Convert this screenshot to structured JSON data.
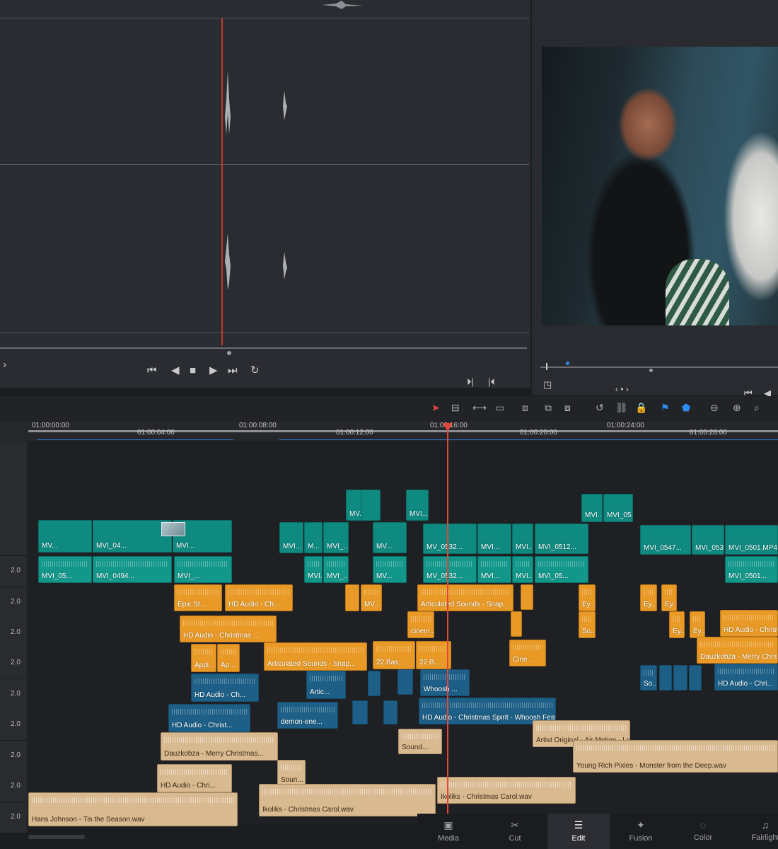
{
  "source_transport": {
    "icons": [
      "go-to-start-icon",
      "step-back-icon",
      "stop-icon",
      "play-icon",
      "go-to-end-icon",
      "loop-icon"
    ],
    "glyphs": [
      "⏮",
      "◀",
      "■",
      "▶",
      "⏭",
      "↻"
    ]
  },
  "record_transport": {
    "glyphs": [
      "◳",
      "⏵|",
      "|⏴",
      "⏮",
      "◀"
    ],
    "nav_label": "‹ • ›"
  },
  "toolbar": {
    "glyphs": [
      "➤",
      "⊟",
      "⟷",
      "▭",
      "⧈",
      "⧉",
      "⧇",
      "↺",
      "⛓",
      "🔒",
      "⚑",
      "⬟",
      "⊖",
      "⊕",
      "⌕"
    ]
  },
  "ruler": {
    "timecodes": [
      "01:00:00:00",
      "01:00:04:00",
      "01:00:08:00",
      "01:00:12:00",
      "01:00:16:00",
      "01:00:20:00",
      "01:00:24:00",
      "01:00:28:00"
    ]
  },
  "track_levels": [
    "2.0",
    "2.0",
    "2.0",
    "2.0",
    "2.0",
    "2.0",
    "2.0",
    "2.0",
    "2.0"
  ],
  "clips": {
    "v_upper": [
      "MV...",
      "MVI...",
      "MVI...",
      "MVI_05..."
    ],
    "v_main": [
      "MV...",
      "MVI_04...",
      "MVI...",
      "MVI...",
      "M...",
      "MVI_...",
      "MV...",
      "MV_0532...",
      "MVI...",
      "MVI...",
      "MVI_0512...",
      "MVI_0547...",
      "MVI_053...",
      "MVI_0501.MP4"
    ],
    "a1": [
      "MVI_05...",
      "MVI_0494...",
      "MVI_...",
      "MVI...",
      "MVI_...",
      "MV...",
      "MV_0532...",
      "MVI...",
      "MVI...",
      "MVI_05...",
      "MVI_0501..."
    ],
    "a2": [
      "Epic St...",
      "HD Audio - Ch...",
      "MV...",
      "Articulated Sounds - Snap...",
      "Ey...",
      "Ey...",
      "Ey..."
    ],
    "a3": [
      "HD Audio - Christmas ...",
      "cinem...",
      "So...",
      "Ey...",
      "Ey...",
      "HD Audio - Christmas ..."
    ],
    "a4": [
      "Appl...",
      "Ap...",
      "Articulated Sounds - Snap...",
      "22 Bas...",
      "22 B...",
      "Cine...",
      "Dauzkobza - Merry Christmas..."
    ],
    "a5": [
      "HD Audio - Ch...",
      "Artic...",
      "Whoosh ...",
      "So...",
      "HD Audio - Chri..."
    ],
    "a6": [
      "HD Audio - Christ...",
      "demon-ene...",
      "HD Audio - Christmas Spirit - Whoosh Festive..."
    ],
    "a7": [
      "Dauzkobza - Merry Christmas...",
      "Sound...",
      "Artist Original - Air Motion - Lon..."
    ],
    "a8": [
      "HD Audio - Chri...",
      "Soun...",
      "Young Rich Pixies - Monster from the Deep.wav"
    ],
    "a9": [
      "Hans Johnson - Tis the Season.wav",
      "Ikoliks - Christmas Carol.wav",
      "Ikoliks - Christmas Carol.wav"
    ]
  },
  "page_nav": {
    "tabs": [
      {
        "label": "Media",
        "icon": "media-icon",
        "glyph": "▣"
      },
      {
        "label": "Cut",
        "icon": "cut-icon",
        "glyph": "✂"
      },
      {
        "label": "Edit",
        "icon": "edit-icon",
        "glyph": "☰"
      },
      {
        "label": "Fusion",
        "icon": "fusion-icon",
        "glyph": "✦"
      },
      {
        "label": "Color",
        "icon": "color-icon",
        "glyph": "◌"
      },
      {
        "label": "Fairlight",
        "icon": "fairlight-icon",
        "glyph": "♫"
      }
    ],
    "active": "Edit"
  },
  "colors": {
    "video_clip": "#0f8a80",
    "linked_audio": "#13978b",
    "orange_audio": "#e99a26",
    "blue_audio": "#1d5f86",
    "tan_audio": "#d9b98f",
    "playhead": "#e0473a"
  }
}
